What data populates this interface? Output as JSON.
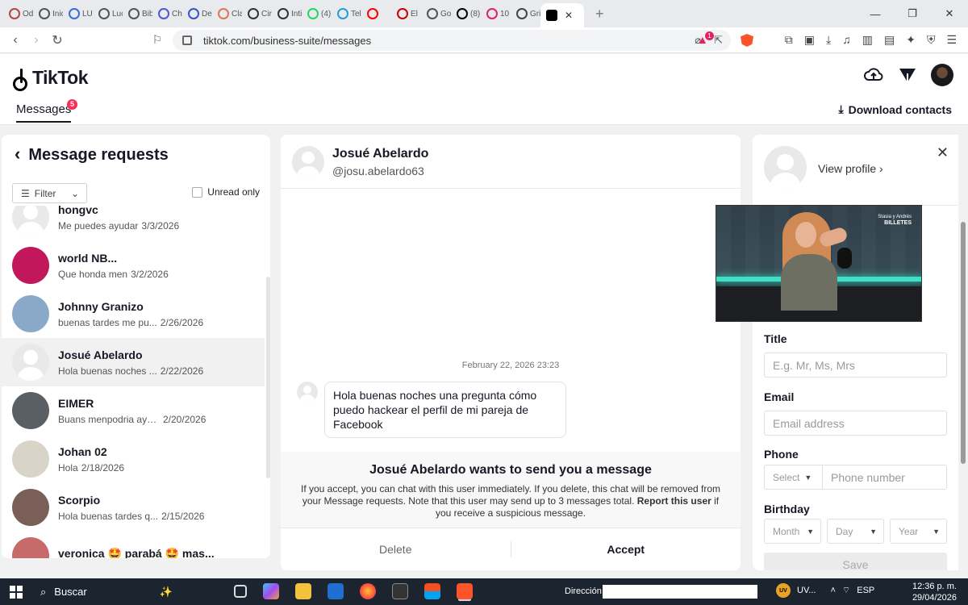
{
  "browser": {
    "tabs": [
      {
        "label": "Od",
        "color": "#b04848"
      },
      {
        "label": "Inic",
        "color": "#555555"
      },
      {
        "label": "LU",
        "color": "#3b6fd8"
      },
      {
        "label": "Luc",
        "color": "#555555"
      },
      {
        "label": "Bib",
        "color": "#555555"
      },
      {
        "label": "Ch",
        "color": "#4a5bd0"
      },
      {
        "label": "De",
        "color": "#3558c8"
      },
      {
        "label": "Cla",
        "color": "#d97757"
      },
      {
        "label": "Cir",
        "color": "#333333"
      },
      {
        "label": "Inti",
        "color": "#333333"
      },
      {
        "label": "(4)",
        "color": "#25d366"
      },
      {
        "label": "Tel",
        "color": "#229ed9"
      },
      {
        "label": "",
        "color": "#ff0000"
      },
      {
        "label": "El",
        "color": "#cc0000"
      },
      {
        "label": "Go",
        "color": "#555555"
      },
      {
        "label": "(8)",
        "color": "#000000"
      },
      {
        "label": "10",
        "color": "#e0245e"
      },
      {
        "label": "Gri",
        "color": "#444444"
      }
    ],
    "address": "tiktok.com/business-suite/messages",
    "shield_count": "1"
  },
  "header": {
    "logo": "TikTok",
    "messages_label": "Messages",
    "messages_badge": "5",
    "download_contacts": "Download contacts"
  },
  "requests": {
    "title": "Message requests",
    "filter_label": "Filter",
    "unread_only": "Unread only",
    "items": [
      {
        "name": "hongvc",
        "preview": "Me puedes ayudar",
        "date": "3/3/2026",
        "avatar": "default"
      },
      {
        "name": "world NB...",
        "preview": "Que honda men",
        "date": "3/2/2026",
        "avatar": "#c2185b"
      },
      {
        "name": "Johnny Granizo",
        "preview": "buenas tardes me pu...",
        "date": "2/26/2026",
        "avatar": "#8aa9c9"
      },
      {
        "name": "Josué Abelardo",
        "preview": "Hola buenas noches ...",
        "date": "2/22/2026",
        "avatar": "default",
        "selected": true
      },
      {
        "name": "EIMER",
        "preview": "Buans menpodria ayu...",
        "date": "2/20/2026",
        "avatar": "#5a5f66"
      },
      {
        "name": "Johan 02",
        "preview": "Hola",
        "date": "2/18/2026",
        "avatar": "#d9d4c8"
      },
      {
        "name": "Scorpio",
        "preview": "Hola buenas tardes q...",
        "date": "2/15/2026",
        "avatar": "#7a5f58"
      },
      {
        "name": "veronica 🤩 parabá 🤩 mas...",
        "preview": "",
        "date": "",
        "avatar": "#c76a6a"
      }
    ]
  },
  "chat": {
    "name": "Josué Abelardo",
    "handle": "@josu.abelardo63",
    "timestamp": "February 22, 2026 23:23",
    "message": "Hola buenas noches una pregunta  cómo puedo hackear el perfil de mi pareja de Facebook",
    "request_title": "Josué Abelardo wants to send you a message",
    "request_desc": "If you accept, you can chat with this user immediately. If you delete, this chat will be removed from your Message requests. Note that this user may send up to 3 messages total.",
    "report_link": "Report this user",
    "request_desc_tail": "if you receive a suspicious message.",
    "delete_label": "Delete",
    "accept_label": "Accept"
  },
  "profile": {
    "view_profile": "View profile",
    "title_label": "Title",
    "title_placeholder": "E.g. Mr, Ms, Mrs",
    "email_label": "Email",
    "email_placeholder": "Email address",
    "phone_label": "Phone",
    "phone_select": "Select",
    "phone_placeholder": "Phone number",
    "birthday_label": "Birthday",
    "month": "Month",
    "day": "Day",
    "year": "Year",
    "save_label": "Save"
  },
  "video_overlay": {
    "watermark_top": "Stasia y Andrés",
    "watermark_bottom": "BILLETES"
  },
  "taskbar": {
    "search_label": "Buscar",
    "direccion_label": "Dirección",
    "tray_label": "UV...",
    "language": "ESP",
    "time": "12:36 p. m.",
    "date": "29/04/2026"
  }
}
